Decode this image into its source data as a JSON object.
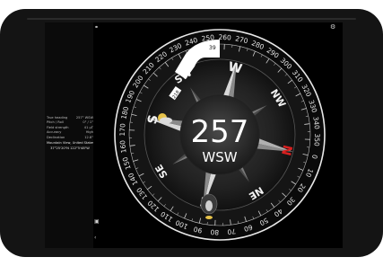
{
  "info": {
    "rows": [
      {
        "label": "True heading",
        "value": "257° WSW"
      },
      {
        "label": "Pitch / Roll",
        "value": "0° / 1°"
      },
      {
        "label": "Field strength",
        "value": "41 µT"
      },
      {
        "label": "Accuracy",
        "value": "High"
      },
      {
        "label": "Declination",
        "value": "12.8°"
      }
    ],
    "location_name": "Mountain View, United States",
    "coordinates": "37°25'20\"N 122°5'48\"W"
  },
  "compass": {
    "heading_value": "257",
    "heading_direction": "WSW",
    "pointer_value": "39",
    "marker_value": "218",
    "ring_numbers": [
      "0",
      "10",
      "20",
      "30",
      "40",
      "50",
      "60",
      "70",
      "80",
      "90",
      "100",
      "110",
      "120",
      "130",
      "140",
      "150",
      "160",
      "170",
      "180",
      "190",
      "200",
      "210",
      "220",
      "230",
      "240",
      "250",
      "260",
      "270",
      "280",
      "290",
      "300",
      "310",
      "320",
      "330",
      "340",
      "350"
    ],
    "directions": [
      "N",
      "NE",
      "E",
      "SE",
      "S",
      "SW",
      "W",
      "NW"
    ]
  },
  "colors": {
    "north": "#d82020",
    "accent_yellow": "#e6c24a",
    "ring": "#e8e8e8"
  },
  "icons": {
    "top_left": "link-icon",
    "top_right": "gear-icon",
    "sidebar_top": "camera-icon",
    "sidebar_bottom": "sun-icon"
  }
}
